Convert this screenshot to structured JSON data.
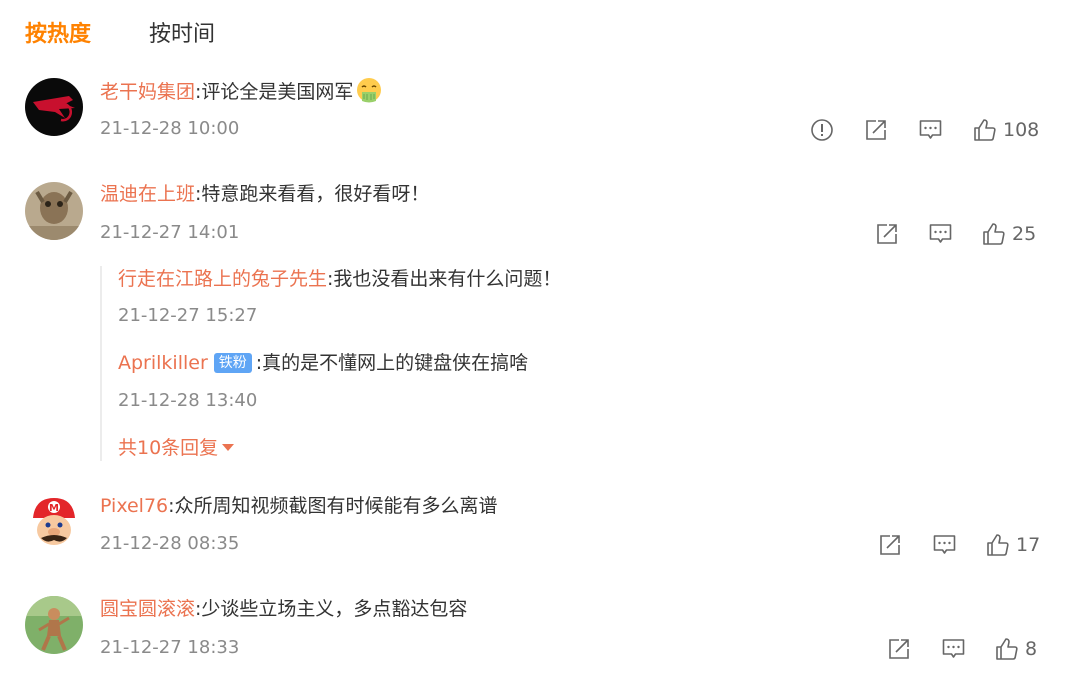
{
  "tabs": {
    "hot": "按热度",
    "time": "按时间"
  },
  "comments": [
    {
      "user": "老干妈集团",
      "text": ":评论全是美国网军",
      "time": "21-12-28 10:00",
      "likes": "108",
      "emoji": "vomit-face"
    },
    {
      "user": "温迪在上班",
      "text": ":特意跑来看看，很好看呀！",
      "time": "21-12-27 14:01",
      "likes": "25",
      "replies": [
        {
          "user": "行走在江路上的兔子先生",
          "text": ":我也没看出来有什么问题！",
          "time": "21-12-27 15:27"
        },
        {
          "user": "Aprilkiller",
          "badge": "铁粉",
          "text": ":真的是不懂网上的键盘侠在搞啥",
          "time": "21-12-28 13:40"
        }
      ],
      "more_replies": "共10条回复"
    },
    {
      "user": "Pixel76",
      "text": ":众所周知视频截图有时候能有多么离谱",
      "time": "21-12-28 08:35",
      "likes": "17"
    },
    {
      "user": "圆宝圆滚滚",
      "text": ":少谈些立场主义，多点豁达包容",
      "time": "21-12-27 18:33",
      "likes": "8"
    }
  ],
  "colors": {
    "accent": "#ff8200",
    "username": "#eb7350",
    "badge": "#5fa5f5"
  },
  "icons": [
    "report-icon",
    "share-icon",
    "comment-icon",
    "like-icon"
  ]
}
